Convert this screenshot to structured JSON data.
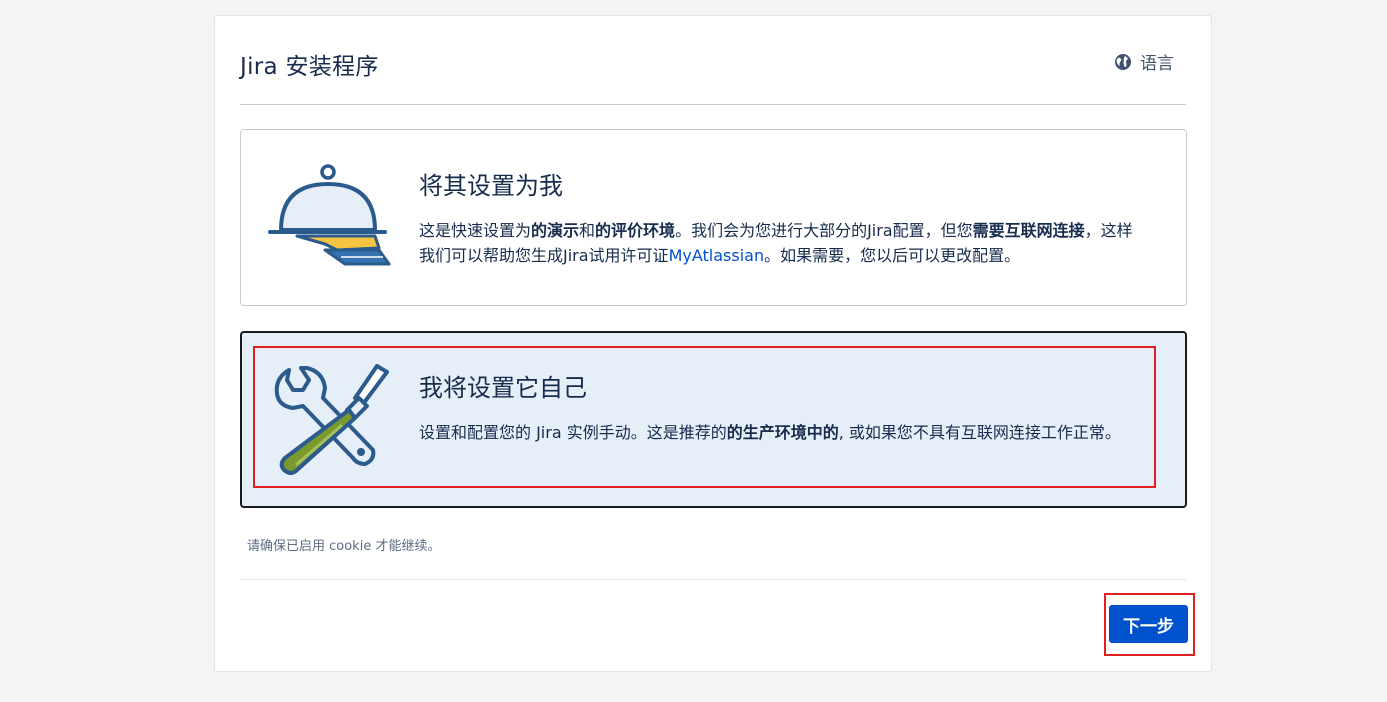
{
  "header": {
    "title": "Jira 安装程序",
    "language_label": "语言"
  },
  "options": [
    {
      "title": "将其设置为我",
      "desc_parts": {
        "t1": "这是快速设置为",
        "b1": "的演示",
        "t2": "和",
        "b2": "的评价环境",
        "t3": "。我们会为您进行大部分的Jira配置，但您",
        "b3": "需要互联网连接",
        "t4": "，这样我们可以帮助您生成Jira试用许可证",
        "link": "MyAtlassian",
        "t5": "。如果需要，您以后可以更改配置。"
      },
      "icon": "serving-cloche-icon"
    },
    {
      "title": "我将设置它自己",
      "desc_parts": {
        "t1": "设置和配置您的 Jira 实例手动。这是推荐的",
        "b1": "的生产环境中的",
        "t2": ", 或如果您不具有互联网连接工作正常。"
      },
      "icon": "wrench-screwdriver-icon"
    }
  ],
  "cookie_notice": "请确保已启用 cookie 才能继续。",
  "footer": {
    "next_label": "下一步"
  },
  "colors": {
    "primary": "#0052cc",
    "selected_bg": "#e6eef8",
    "highlight_red": "#e02020"
  }
}
